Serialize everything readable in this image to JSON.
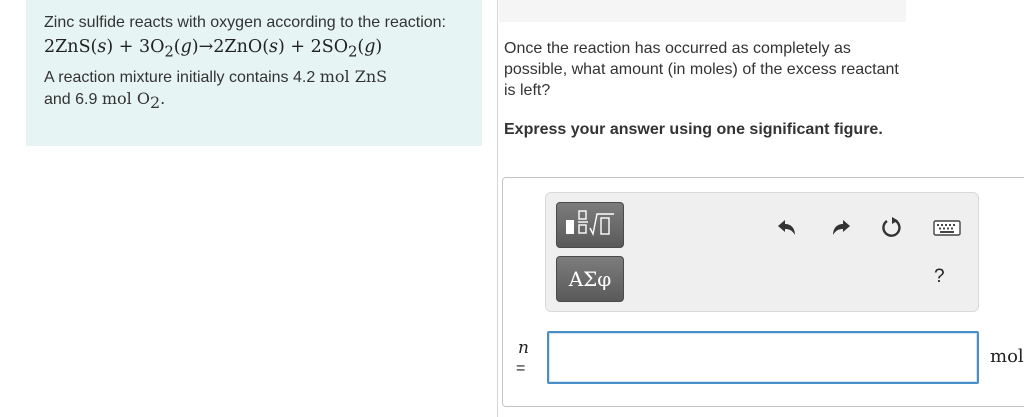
{
  "info": {
    "intro": "Zinc sulfide reacts with oxygen according to the reaction:",
    "equation": {
      "p1": "2ZnS(",
      "s1": "s",
      "p2": ") + 3O",
      "sub1": "2",
      "p3": "(",
      "g1": "g",
      "p4": ")→2ZnO(",
      "s2": "s",
      "p5": ") + 2SO",
      "sub2": "2",
      "p6": "(",
      "g2": "g",
      "p7": ")"
    },
    "line3_pre": "A reaction mixture initially contains 4.2 ",
    "line3_unit": "mol ZnS",
    "line4_pre": "and 6.9 ",
    "line4_unit": "mol O",
    "line4_sub": "2",
    "line4_end": "."
  },
  "question": {
    "text": "Once the reaction has occurred as completely as possible, what amount (in moles) of the excess reactant is left?",
    "instruction": "Express your answer using one significant figure."
  },
  "toolbar": {
    "greek_label": "ΑΣφ",
    "help_label": "?",
    "icons": [
      "templates-icon",
      "greek-symbols-icon",
      "undo-icon",
      "redo-icon",
      "reset-icon",
      "keyboard-icon",
      "help-icon"
    ]
  },
  "answer": {
    "variable": "n",
    "equals": "=",
    "value": "",
    "unit": "mol"
  }
}
